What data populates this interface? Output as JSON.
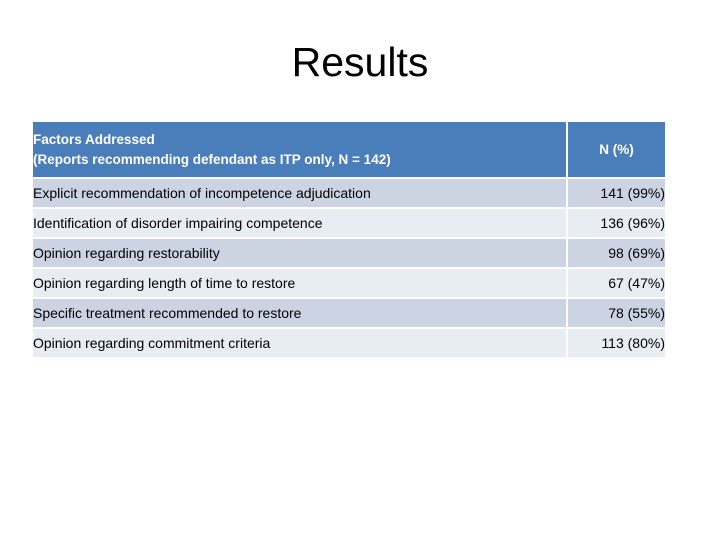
{
  "slide": {
    "title": "Results"
  },
  "table": {
    "columns": [
      {
        "header_line1": "Factors Addressed",
        "header_line2": "(Reports recommending defendant as ITP only, N = 142)"
      },
      {
        "header_line1": "N (%)"
      }
    ],
    "rows": [
      {
        "factor": "Explicit recommendation of incompetence adjudication",
        "value": "141 (99%)"
      },
      {
        "factor": "Identification of disorder impairing competence",
        "value": "136 (96%)"
      },
      {
        "factor": "Opinion regarding restorability",
        "value": "98 (69%)"
      },
      {
        "factor": "Opinion regarding length of time to restore",
        "value": "67 (47%)"
      },
      {
        "factor": "Specific treatment recommended to restore",
        "value": "78 (55%)"
      },
      {
        "factor": "Opinion regarding commitment criteria",
        "value": "113 (80%)"
      }
    ]
  },
  "colors": {
    "header_blue": "#4a7ebb",
    "band_dark": "#ccd4e4",
    "band_light": "#e8ecf3",
    "text": "#000000",
    "header_text": "#ffffff"
  },
  "chart_data": {
    "type": "table",
    "title": "Results",
    "columns": [
      "Factors Addressed (Reports recommending defendant as ITP only, N = 142)",
      "N (%)"
    ],
    "categories": [
      "Explicit recommendation of incompetence adjudication",
      "Identification of disorder impairing competence",
      "Opinion regarding restorability",
      "Opinion regarding length of time to restore",
      "Specific treatment recommended to restore",
      "Opinion regarding commitment criteria"
    ],
    "values": [
      141,
      136,
      98,
      67,
      78,
      113
    ],
    "percents": [
      99,
      96,
      69,
      47,
      55,
      80
    ],
    "total_n": 142,
    "value_labels": [
      "141 (99%)",
      "136 (96%)",
      "98 (69%)",
      "67 (47%)",
      "78 (55%)",
      "113 (80%)"
    ],
    "xlabel": "",
    "ylabel": "N (%)"
  }
}
